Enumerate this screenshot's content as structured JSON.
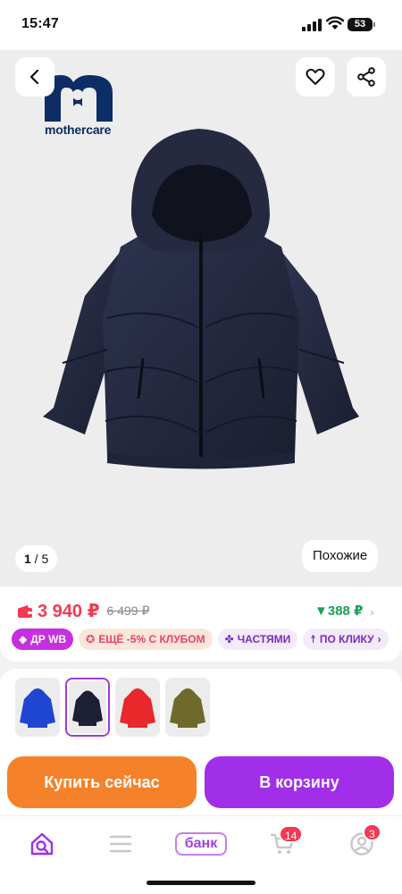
{
  "status_bar": {
    "time": "15:47",
    "battery": "53"
  },
  "hero": {
    "brand_text": "mothercare",
    "pager_current": "1",
    "pager_total": "5",
    "similar_label": "Похожие"
  },
  "price": {
    "current": "3 940 ₽",
    "old": "6 499 ₽",
    "drop": "▼388 ₽"
  },
  "chips": {
    "dr_wb": "ДР WB",
    "club": "ЕЩЁ -5% С КЛУБОМ",
    "parts": "ЧАСТЯМИ",
    "click": "ПО КЛИКУ"
  },
  "variants": [
    {
      "color": "#1f46d0",
      "selected": false
    },
    {
      "color": "#1d2034",
      "selected": true
    },
    {
      "color": "#e8282b",
      "selected": false
    },
    {
      "color": "#6d6a2c",
      "selected": false
    }
  ],
  "actions": {
    "buy_now": "Купить сейчас",
    "add_to_cart": "В корзину"
  },
  "tabbar": {
    "bank_label": "банк",
    "cart_count": "14",
    "profile_count": "3"
  },
  "colors": {
    "accent_purple": "#a12ee8",
    "buy_orange": "#f5822a",
    "price_red": "#f23a54",
    "drop_green": "#1aa156"
  }
}
